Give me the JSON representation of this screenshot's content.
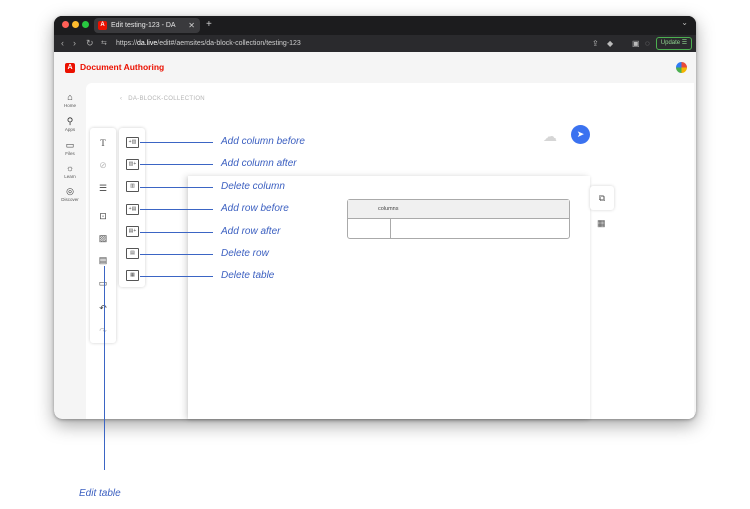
{
  "browser": {
    "tab_title": "Edit testing-123 - DA",
    "tab_favicon": "A",
    "new_tab": "+",
    "url_prefix": "https://",
    "url_domain": "da.live",
    "url_path": "/edit#/aemsites/da-block-collection/testing-123",
    "update_label": "Update ☰"
  },
  "app": {
    "logo_letter": "A",
    "title": "Document Authoring",
    "accent_color": "#eb1000"
  },
  "leftnav": [
    {
      "label": "Home",
      "icon": "home-icon"
    },
    {
      "label": "Apps",
      "icon": "apps-icon"
    },
    {
      "label": "Files",
      "icon": "folder-icon"
    },
    {
      "label": "Learn",
      "icon": "lightbulb-icon"
    },
    {
      "label": "Discover",
      "icon": "compass-icon"
    }
  ],
  "editor": {
    "breadcrumb_back": "‹",
    "breadcrumb": "DA-BLOCK-COLLECTION",
    "table_header": "columns"
  },
  "toolbar_icons": [
    "text-icon",
    "link-icon",
    "list-icon",
    "block-icon",
    "image-icon",
    "edit-table-icon",
    "section-icon",
    "undo-icon",
    "redo-icon"
  ],
  "table_tools": [
    {
      "label": "Add column before",
      "icon": "add-column-before-icon"
    },
    {
      "label": "Add column after",
      "icon": "add-column-after-icon"
    },
    {
      "label": "Delete column",
      "icon": "delete-column-icon"
    },
    {
      "label": "Add row before",
      "icon": "add-row-before-icon"
    },
    {
      "label": "Add row after",
      "icon": "add-row-after-icon"
    },
    {
      "label": "Delete row",
      "icon": "delete-row-icon"
    },
    {
      "label": "Delete table",
      "icon": "delete-table-icon"
    }
  ],
  "edit_table_label": "Edit table",
  "callout_color": "#3b5fc0"
}
